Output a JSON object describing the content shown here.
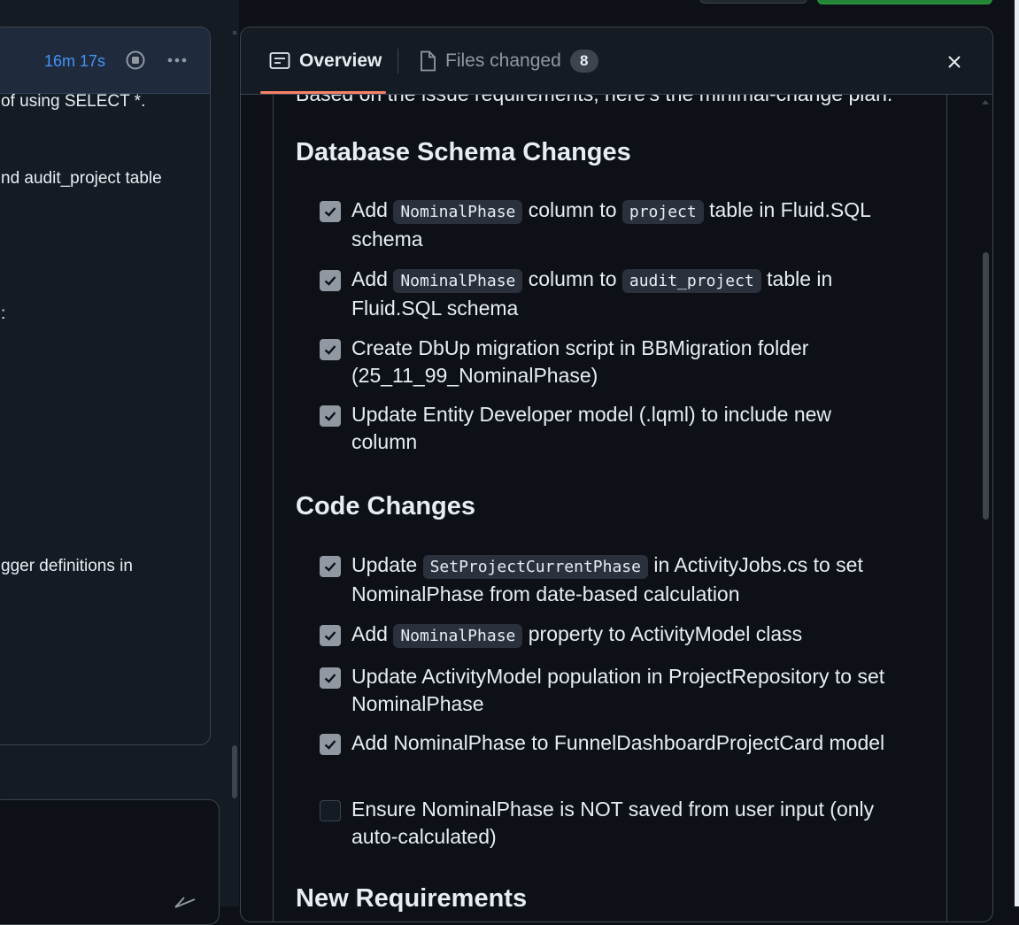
{
  "left_panel": {
    "timer": "16m 17s",
    "fragments": [
      "of using SELECT *.",
      "nd audit_project table",
      ":",
      "gger definitions in"
    ]
  },
  "panel": {
    "tabs": [
      {
        "label": "Overview",
        "icon": "overview-icon",
        "active": true
      },
      {
        "label": "Files changed",
        "icon": "file-icon",
        "count": "8"
      }
    ],
    "cut_text": "Based on the issue requirements, here's the minimal-change plan:",
    "sections": [
      {
        "title": "Database Schema Changes",
        "tasks": [
          {
            "checked": true,
            "parts": [
              "Add ",
              "NominalPhase",
              " column to ",
              "project",
              " table in Fluid.SQL schema"
            ]
          },
          {
            "checked": true,
            "parts": [
              "Add ",
              "NominalPhase",
              " column to ",
              "audit_project",
              " table in Fluid.SQL schema"
            ]
          },
          {
            "checked": true,
            "text": "Create DbUp migration script in BBMigration folder (25_11_99_NominalPhase)"
          },
          {
            "checked": true,
            "text": "Update Entity Developer model (.lqml) to include new column"
          }
        ]
      },
      {
        "title": "Code Changes",
        "tasks": [
          {
            "checked": true,
            "parts": [
              "Update ",
              "SetProjectCurrentPhase",
              " in ActivityJobs.cs to set NominalPhase from date-based calculation"
            ]
          },
          {
            "checked": true,
            "parts": [
              "Add ",
              "NominalPhase",
              " property to ActivityModel class"
            ]
          },
          {
            "checked": true,
            "text": "Update ActivityModel population in ProjectRepository to set NominalPhase"
          },
          {
            "checked": true,
            "text": "Add NominalPhase to FunnelDashboardProjectCard model"
          },
          {
            "checked": false,
            "text": "Ensure NominalPhase is NOT saved from user input (only auto-calculated)"
          }
        ]
      },
      {
        "title": "New Requirements"
      }
    ]
  },
  "colors": {
    "accent": "#4493f8",
    "tab_underline": "#f78166",
    "background": "#0d1117"
  }
}
